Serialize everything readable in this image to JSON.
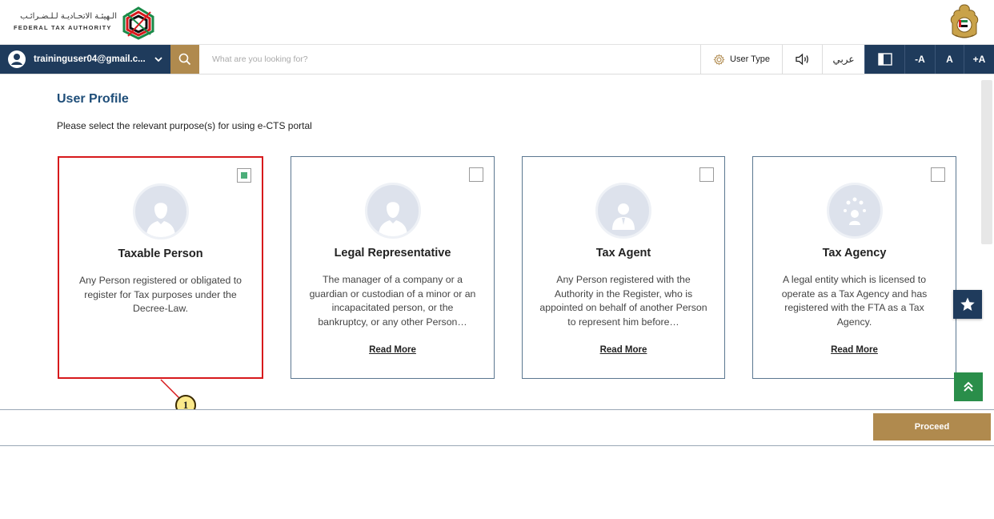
{
  "header": {
    "org_name_ar": "الـهيئـة الاتحـاديـة لـلـضـرائـب",
    "org_name_en": "FEDERAL TAX AUTHORITY",
    "logo_icon": "fta-logo-icon",
    "emblem_icon": "uae-emblem-icon"
  },
  "navbar": {
    "user_email": "traininguser04@gmail.c...",
    "search_placeholder": "What are you looking for?",
    "user_type_label": "User Type",
    "language_label": "عربي",
    "font_decrease": "-A",
    "font_normal": "A",
    "font_increase": "+A"
  },
  "main": {
    "title": "User Profile",
    "subtitle": "Please select the relevant purpose(s) for using e-CTS portal",
    "cards": [
      {
        "title": "Taxable Person",
        "description": "Any Person registered or obligated to register for Tax purposes under the Decree-Law.",
        "checked": true,
        "read_more": ""
      },
      {
        "title": "Legal Representative",
        "description": "The manager of a company or a guardian or custodian of a minor or an incapacitated person, or the bankruptcy, or any other Person…",
        "checked": false,
        "read_more": "Read More"
      },
      {
        "title": "Tax Agent",
        "description": "Any Person registered with the Authority in the Register, who is appointed on behalf of another Person to represent him before…",
        "checked": false,
        "read_more": "Read More"
      },
      {
        "title": "Tax Agency",
        "description": "A legal entity which is licensed to operate as a Tax Agency and has registered with the FTA as a Tax Agency.",
        "checked": false,
        "read_more": "Read More"
      }
    ]
  },
  "annotation": {
    "number": "1"
  },
  "footer": {
    "proceed_label": "Proceed"
  },
  "colors": {
    "navy": "#1f3b5c",
    "gold": "#b08a4e",
    "selected_border": "#d7191c",
    "checked_fill": "#4cae7a",
    "title_blue": "#1f4e79"
  }
}
